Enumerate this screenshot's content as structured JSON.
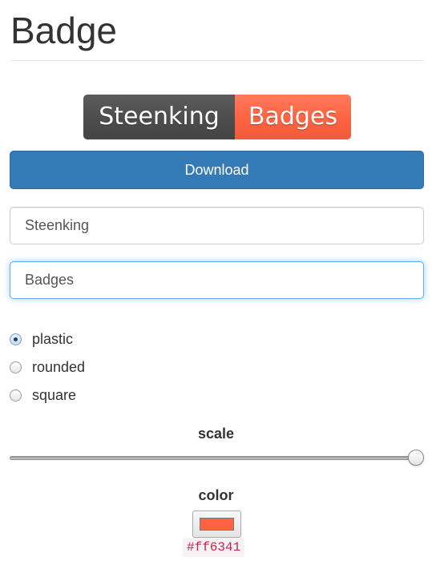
{
  "page": {
    "title": "Badge"
  },
  "badge": {
    "left_text": "Steenking",
    "right_text": "Badges"
  },
  "download_button": {
    "label": "Download"
  },
  "fields": {
    "left_value": "Steenking",
    "right_value": "Badges"
  },
  "style_options": {
    "selected": "plastic",
    "items": [
      {
        "label": "plastic",
        "checked": true
      },
      {
        "label": "rounded",
        "checked": false
      },
      {
        "label": "square",
        "checked": false
      }
    ]
  },
  "scale": {
    "label": "scale",
    "value_fraction": 1.0
  },
  "color": {
    "label": "color",
    "value": "#ff6341"
  },
  "colors": {
    "badge_left_bg": "#555555",
    "badge_right_bg": "#ff6341",
    "primary_button": "#337ab7",
    "code_text": "#c7254e"
  }
}
